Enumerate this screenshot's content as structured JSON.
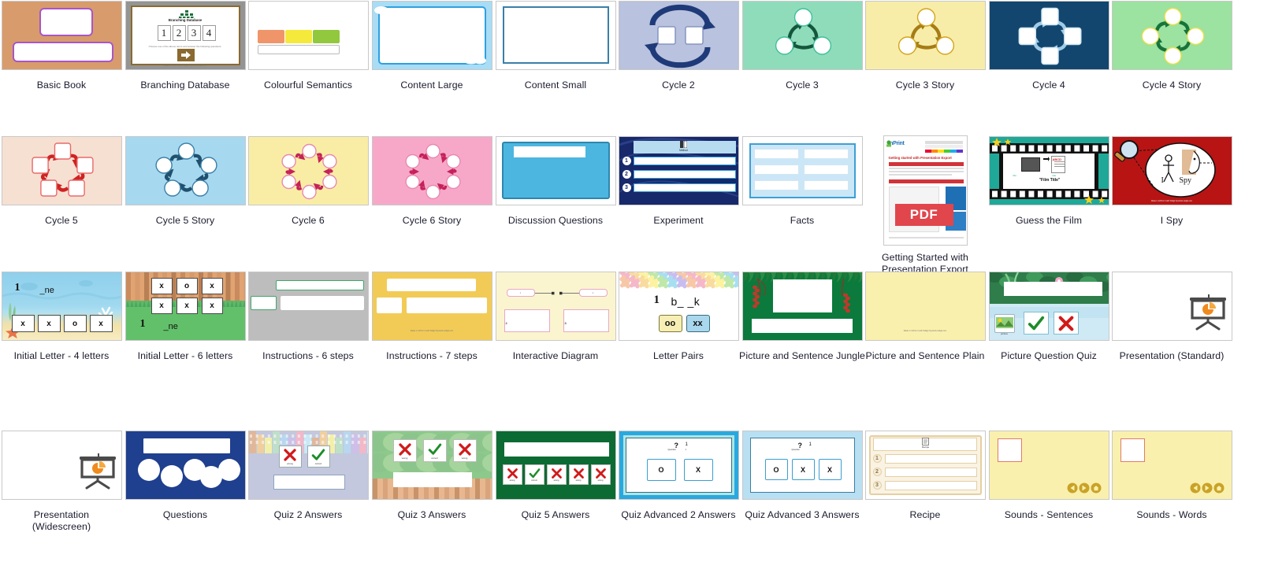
{
  "page": {
    "type": "template-gallery",
    "columns": 10,
    "rows": 4,
    "total_items": 40,
    "background": "#ffffff",
    "caption_color": "#1a1a2e"
  },
  "templates": [
    {
      "id": "basic-book",
      "label": "Basic Book",
      "row": 1,
      "col": 1,
      "bg": "#d89b6c",
      "accent": "#a855c8"
    },
    {
      "id": "branching-database",
      "label": "Branching Database",
      "row": 1,
      "col": 2,
      "bg": "#949494",
      "accent": "#8a6a2f",
      "inner_title": "Branching Database",
      "numbers": [
        "1",
        "2",
        "3",
        "4"
      ],
      "sub_text": "Choose one of the above items and answer the following questions.",
      "footer": "Made in InPrint 3 with Widgit Symbols widgit.com"
    },
    {
      "id": "colourful-semantics",
      "label": "Colourful Semantics",
      "row": 1,
      "col": 3,
      "bg": "#ffffff",
      "swatches": [
        "#f0956a",
        "#f5e93c",
        "#92c83e"
      ]
    },
    {
      "id": "content-large",
      "label": "Content Large",
      "row": 1,
      "col": 4,
      "bg": "#a8ddf5",
      "accent": "#2f9fe0"
    },
    {
      "id": "content-small",
      "label": "Content Small",
      "row": 1,
      "col": 5,
      "bg": "#ffffff",
      "accent": "#3a7fa8"
    },
    {
      "id": "cycle-2",
      "label": "Cycle 2",
      "row": 1,
      "col": 6,
      "bg": "#b9c2de",
      "accent": "#1f3a78",
      "nodes": 2,
      "shape": "square"
    },
    {
      "id": "cycle-3",
      "label": "Cycle 3",
      "row": 1,
      "col": 7,
      "bg": "#8fdcbb",
      "accent": "#14563c",
      "nodes": 3,
      "shape": "circle"
    },
    {
      "id": "cycle-3-story",
      "label": "Cycle 3 Story",
      "row": 1,
      "col": 8,
      "bg": "#f7eda8",
      "accent": "#a67c16",
      "nodes": 3,
      "shape": "circle"
    },
    {
      "id": "cycle-4",
      "label": "Cycle 4",
      "row": 1,
      "col": 9,
      "bg": "#12466e",
      "accent": "#9fcbe6",
      "nodes": 4,
      "shape": "square"
    },
    {
      "id": "cycle-4-story",
      "label": "Cycle 4 Story",
      "row": 1,
      "col": 10,
      "bg": "#9ce2a0",
      "accent": "#16733a",
      "nodes": 4,
      "shape": "circle"
    },
    {
      "id": "cycle-5",
      "label": "Cycle 5",
      "row": 2,
      "col": 1,
      "bg": "#f6e0d2",
      "accent": "#cf2222",
      "nodes": 5,
      "shape": "square"
    },
    {
      "id": "cycle-5-story",
      "label": "Cycle 5 Story",
      "row": 2,
      "col": 2,
      "bg": "#a6d9ef",
      "accent": "#20506e",
      "nodes": 5,
      "shape": "circle"
    },
    {
      "id": "cycle-6",
      "label": "Cycle 6",
      "row": 2,
      "col": 3,
      "bg": "#f9eda5",
      "accent": "#c62159",
      "nodes": 6,
      "shape": "circle"
    },
    {
      "id": "cycle-6-story",
      "label": "Cycle 6 Story",
      "row": 2,
      "col": 4,
      "bg": "#f7a8c8",
      "accent": "#c62159",
      "nodes": 6,
      "shape": "circle"
    },
    {
      "id": "discussion-questions",
      "label": "Discussion Questions",
      "row": 2,
      "col": 5,
      "bg": "#ffffff",
      "accent": "#4cb6e0"
    },
    {
      "id": "experiment",
      "label": "Experiment",
      "row": 2,
      "col": 6,
      "bg": "#17286b",
      "accent": "#b7dcf0",
      "header_label": "Method",
      "rows": [
        "1",
        "2",
        "3"
      ]
    },
    {
      "id": "facts",
      "label": "Facts",
      "row": 2,
      "col": 7,
      "bg": "#ffffff",
      "accent": "#3f9ed4",
      "cells": 6
    },
    {
      "id": "getting-started",
      "label": "Getting Started with Presentation Export",
      "row": 2,
      "col": 8,
      "bg": "#ffffff",
      "orientation": "portrait",
      "brand": "InPrint",
      "doc_heading": "Getting started with Presentation Export",
      "badge": "PDF",
      "badge_color": "#e0464c"
    },
    {
      "id": "guess-the-film",
      "label": "Guess the Film",
      "row": 2,
      "col": 9,
      "bg": "#1fa898",
      "accent": "#111111",
      "film_title": "\"Film Title\""
    },
    {
      "id": "i-spy",
      "label": "I Spy",
      "row": 2,
      "col": 10,
      "bg": "#b81414",
      "words": [
        "I",
        "Spy"
      ]
    },
    {
      "id": "initial-letter-4",
      "label": "Initial Letter - 4 letters",
      "row": 3,
      "col": 1,
      "bg": "#7ec6e8",
      "prompt_number": "1",
      "prompt_word": "_ne",
      "letters": [
        "x",
        "x",
        "o",
        "x"
      ]
    },
    {
      "id": "initial-letter-6",
      "label": "Initial Letter - 6 letters",
      "row": 3,
      "col": 2,
      "bg": "#62c06a",
      "prompt_number": "1",
      "prompt_word": "_ne",
      "letters": [
        "x",
        "o",
        "x",
        "x",
        "x",
        "x"
      ]
    },
    {
      "id": "instructions-6",
      "label": "Instructions -  6 steps",
      "row": 3,
      "col": 3,
      "bg": "#bdbdbd",
      "accent": "#43a56d"
    },
    {
      "id": "instructions-7",
      "label": "Instructions -  7 steps",
      "row": 3,
      "col": 4,
      "bg": "#f2cb57",
      "accent": "#ffffff",
      "footer": "Made in InPrint 3 with Widgit Symbols widgit.com"
    },
    {
      "id": "interactive-diagram",
      "label": "Interactive Diagram",
      "row": 3,
      "col": 5,
      "bg": "#fbf5cf",
      "accent": "#e8a8c8",
      "tags": [
        "1",
        "2"
      ],
      "panels": [
        "2",
        "3"
      ]
    },
    {
      "id": "letter-pairs",
      "label": "Letter Pairs",
      "row": 3,
      "col": 6,
      "bg": "#ffffff",
      "prompt_number": "1",
      "prompt_word": "b_ _k",
      "options": [
        "oo",
        "xx"
      ],
      "option_colors": [
        "#f6eeb4",
        "#a9d8ee"
      ]
    },
    {
      "id": "picture-sentence-jungle",
      "label": "Picture and Sentence Jungle",
      "row": 3,
      "col": 7,
      "bg": "#0b7a3c"
    },
    {
      "id": "picture-sentence-plain",
      "label": "Picture and Sentence Plain",
      "row": 3,
      "col": 8,
      "bg": "#faf0ad",
      "footer": "Made in InPrint 3 with Widgit Symbols widgit.com"
    },
    {
      "id": "picture-question-quiz",
      "label": "Picture Question Quiz",
      "row": 3,
      "col": 9,
      "bg": "#cfeaf5",
      "picture_caption": "picture",
      "marks": [
        "tick",
        "cross"
      ]
    },
    {
      "id": "presentation-standard",
      "label": "Presentation (Standard)",
      "row": 3,
      "col": 10,
      "bg": "#ffffff",
      "icon": "presentation-icon"
    },
    {
      "id": "presentation-widescreen",
      "label": "Presentation\n(Widescreen)",
      "row": 4,
      "col": 1,
      "bg": "#ffffff",
      "icon": "presentation-icon"
    },
    {
      "id": "questions",
      "label": "Questions",
      "row": 4,
      "col": 2,
      "bg": "#1f3f8f",
      "circles": 5
    },
    {
      "id": "quiz-2-answers",
      "label": "Quiz 2 Answers",
      "row": 4,
      "col": 3,
      "bg": "#c3c8de",
      "marks": [
        "cross",
        "tick"
      ],
      "mark_labels": [
        "wrong",
        "correct"
      ]
    },
    {
      "id": "quiz-3-answers",
      "label": "Quiz 3 Answers",
      "row": 4,
      "col": 4,
      "bg": "#8cc98b",
      "marks": [
        "cross",
        "tick",
        "cross"
      ],
      "mark_labels": [
        "wrong",
        "correct",
        "wrong"
      ]
    },
    {
      "id": "quiz-5-answers",
      "label": "Quiz 5 Answers",
      "row": 4,
      "col": 5,
      "bg": "#0b6b33",
      "marks": [
        "cross",
        "tick",
        "cross",
        "cross",
        "cross"
      ],
      "mark_labels": [
        "wrong",
        "correct",
        "wrong",
        "wrong",
        "wrong"
      ]
    },
    {
      "id": "quiz-advanced-2",
      "label": "Quiz Advanced 2 Answers",
      "row": 4,
      "col": 6,
      "bg": "#29a8e0",
      "question_mark": "?",
      "question_label": "Question",
      "question_number": "1",
      "options": [
        "O",
        "X"
      ]
    },
    {
      "id": "quiz-advanced-3",
      "label": "Quiz Advanced 3 Answers",
      "row": 4,
      "col": 7,
      "bg": "#b9dff2",
      "question_mark": "?",
      "question_label": "Question",
      "question_number": "1",
      "options": [
        "O",
        "X",
        "X"
      ]
    },
    {
      "id": "recipe",
      "label": "Recipe",
      "row": 4,
      "col": 8,
      "bg": "#ffffff",
      "accent": "#e6cfa0",
      "header_label": "Recipe",
      "rows": [
        "1",
        "2",
        "3"
      ]
    },
    {
      "id": "sounds-sentences",
      "label": "Sounds - Sentences",
      "row": 4,
      "col": 9,
      "bg": "#faf0ad",
      "accent": "#e07b6a",
      "nav_icons": [
        "back-icon",
        "forward-icon",
        "home-icon"
      ]
    },
    {
      "id": "sounds-words",
      "label": "Sounds - Words",
      "row": 4,
      "col": 10,
      "bg": "#faf0ad",
      "accent": "#e07b6a",
      "nav_icons": [
        "back-icon",
        "forward-icon",
        "home-icon"
      ]
    }
  ]
}
